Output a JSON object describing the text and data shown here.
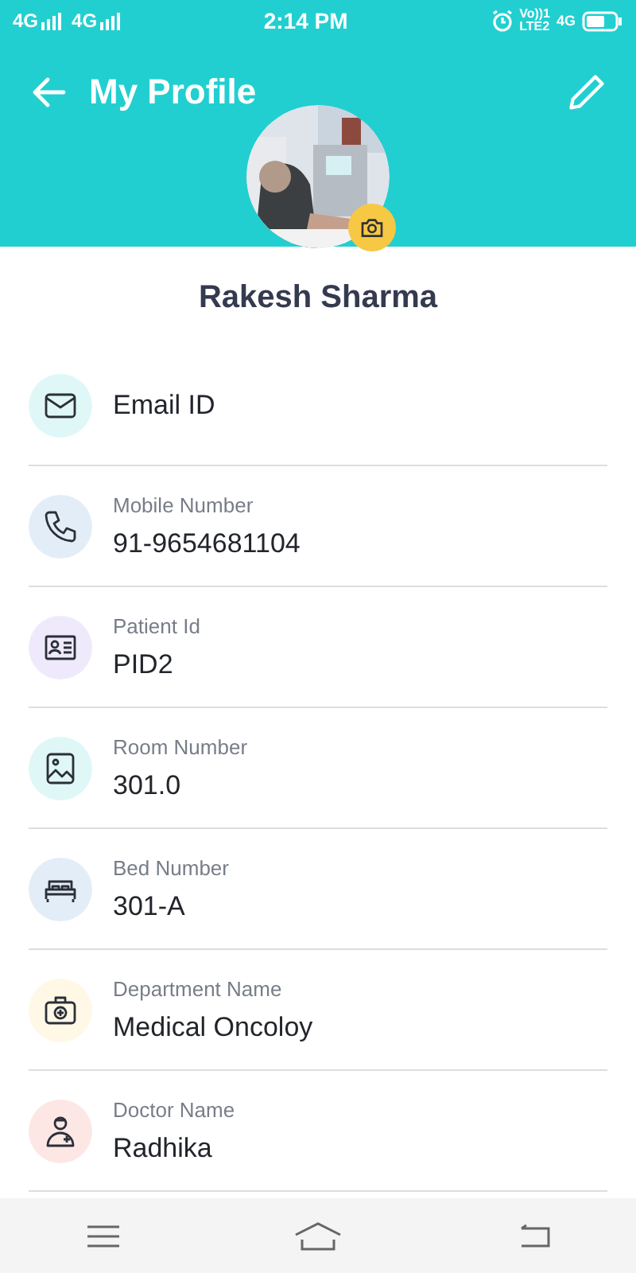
{
  "status_bar": {
    "carriers": [
      "4G",
      "4G"
    ],
    "time": "2:14 PM",
    "volte": "Vo))1",
    "lte": "LTE2",
    "network": "4G"
  },
  "header": {
    "title": "My Profile"
  },
  "profile": {
    "name": "Rakesh Sharma"
  },
  "fields": [
    {
      "value": "Email ID",
      "color": "#e0f7f7"
    },
    {
      "label": "Mobile Number",
      "value": "91-9654681104",
      "color": "#e3edf7"
    },
    {
      "label": "Patient Id",
      "value": "PID2",
      "color": "#efeafb"
    },
    {
      "label": "Room Number",
      "value": "301.0",
      "color": "#e0f7f7"
    },
    {
      "label": "Bed Number",
      "value": "301-A",
      "color": "#e3edf7"
    },
    {
      "label": "Department Name",
      "value": "Medical Oncoloy",
      "color": "#fff8e6"
    },
    {
      "label": "Doctor Name",
      "value": "Radhika",
      "color": "#fde7e4"
    }
  ]
}
